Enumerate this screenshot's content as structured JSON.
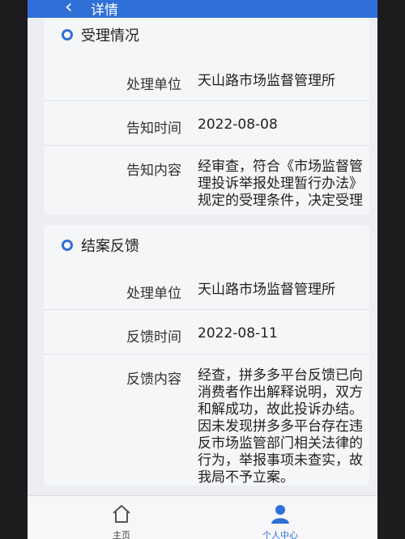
{
  "header": {
    "title": "详情"
  },
  "section1": {
    "title": "受理情况",
    "rows": [
      {
        "label": "处理单位",
        "value": "天山路市场监督管理所"
      },
      {
        "label": "告知时间",
        "value": "2022-08-08"
      },
      {
        "label": "告知内容",
        "value": "经审查，符合《市场监督管理投诉举报处理暂行办法》规定的受理条件，决定受理"
      }
    ]
  },
  "section2": {
    "title": "结案反馈",
    "rows": [
      {
        "label": "处理单位",
        "value": "天山路市场监督管理所"
      },
      {
        "label": "反馈时间",
        "value": "2022-08-11"
      },
      {
        "label": "反馈内容",
        "value": "经查，拼多多平台反馈已向消费者作出解释说明，双方和解成功，故此投诉办结。因未发现拼多多平台存在违反市场监管部门相关法律的行为，举报事项未查实，故我局不予立案。"
      }
    ]
  },
  "nav": {
    "home_label": "主页",
    "me_label": "个人中心"
  },
  "colors": {
    "accent": "#2e6fd8"
  }
}
